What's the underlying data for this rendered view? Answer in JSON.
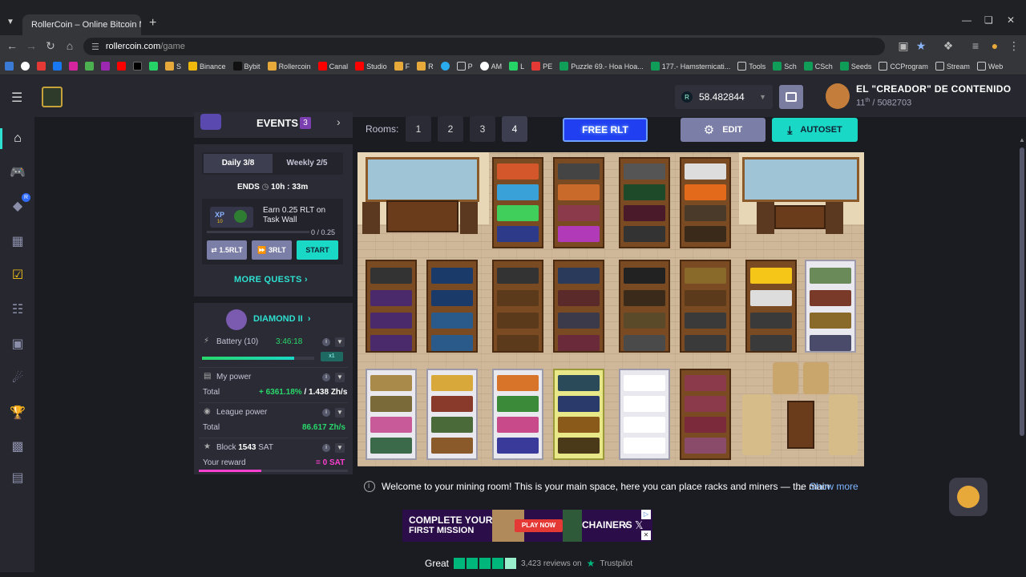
{
  "browser": {
    "tab_title": "RollerCoin – Online Bitcoin Mi",
    "url_host": "rollercoin.com",
    "url_path": "/game",
    "bookmarks": [
      "Binance",
      "Bybit",
      "Rollercoin",
      "Canal",
      "Studio",
      "F",
      "R",
      "P",
      "AM",
      "L",
      "PE",
      "Puzzle 69.- Hoa Hoa...",
      "177.- Hamsternicati...",
      "Tools",
      "Sch",
      "CSch",
      "Seeds",
      "CCProgram",
      "Stream",
      "Web"
    ]
  },
  "header": {
    "balance": "58.482844",
    "username": "EL \"CREADOR\" DE CONTENIDO",
    "rank_num": "11",
    "rank_sup": "th",
    "rank_total": "/ 5082703"
  },
  "sidebar": {
    "badge": "R"
  },
  "events": {
    "title": "EVENTS",
    "count": "3"
  },
  "quests": {
    "tab_daily": "Daily  3/8",
    "tab_weekly": "Weekly  2/5",
    "ends_label": "ENDS",
    "ends_time": "10h : 33m",
    "task_text": "Earn 0.25 RLT on Task Wall",
    "task_progress_text": "0 / 0.25",
    "task_progress_fraction": 0.0,
    "xp_badge": "XP",
    "xp_value": "10",
    "btn_a": "1.5RLT",
    "btn_b": "3RLT",
    "btn_start": "START",
    "more": "MORE QUESTS"
  },
  "league": {
    "title": "DIAMOND II",
    "battery_label": "Battery (10)",
    "battery_time": "3:46:18",
    "battery_fill": 0.82,
    "battery_tag": "x1",
    "my_power_label": "My power",
    "total_label": "Total",
    "my_power_pct": "+ 6361.18%",
    "my_power_sep": "/",
    "my_power_val": "1.438 Zh/s",
    "league_power_label": "League power",
    "league_total_label": "Total",
    "league_power_val": "86.617 Zh/s",
    "block_label": "Block",
    "block_num": "1543",
    "block_unit": "SAT",
    "reward_label": "Your reward",
    "reward_val": "= 0 SAT"
  },
  "rooms": {
    "label": "Rooms:",
    "numbers": [
      "1",
      "2",
      "3",
      "4"
    ],
    "selected": "4",
    "free_rlt": "FREE RLT",
    "edit": "EDIT",
    "autoset": "AUTOSET"
  },
  "welcome": {
    "text": "Welcome to your mining room! This is your main space, here you can place racks and miners — the main",
    "ellipsis": "...",
    "show_more": "Show more"
  },
  "banner": {
    "line1": "COMPLETE YOUR",
    "line2": "FIRST MISSION",
    "play": "PLAY NOW",
    "brand": "CHAINERS",
    "x": "x"
  },
  "trust": {
    "text": "Great",
    "reviews": "3,423 reviews on",
    "brand": "Trustpilot"
  },
  "colors": {
    "accent_teal": "#19d8c6",
    "accent_blue": "#1f3ff0",
    "positive": "#29d86a",
    "reward": "#ff3fd0"
  }
}
